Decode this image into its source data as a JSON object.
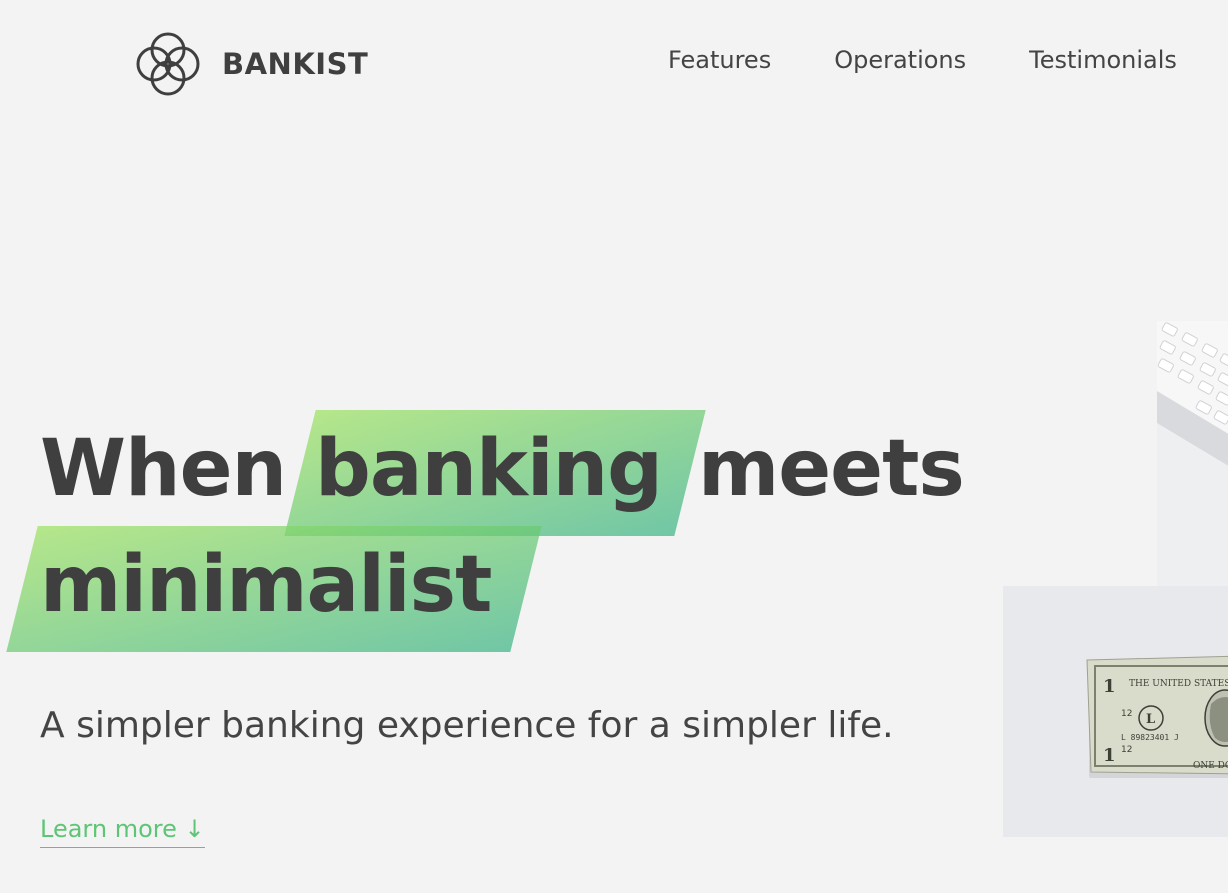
{
  "header": {
    "logo_text": "BANKIST",
    "nav": [
      {
        "label": "Features"
      },
      {
        "label": "Operations"
      },
      {
        "label": "Testimonials"
      }
    ]
  },
  "hero": {
    "title_word_1": "When",
    "title_highlight_1": "banking",
    "title_word_2": "meets",
    "title_highlight_2": "minimalist",
    "subtitle": "A simpler banking experience for a simpler life.",
    "learn_more": "Learn more ↓",
    "banknote_text": {
      "header": "THE UNITED STATES",
      "serial": "L 89823401 J",
      "corner": "12",
      "letter": "L",
      "numeral": "1",
      "footer": "ONE DOLLAR"
    }
  },
  "colors": {
    "background": "#f3f3f3",
    "text": "#444444",
    "accent": "#5ec576",
    "highlight_start": "#9be15d",
    "highlight_end": "#39b385"
  }
}
